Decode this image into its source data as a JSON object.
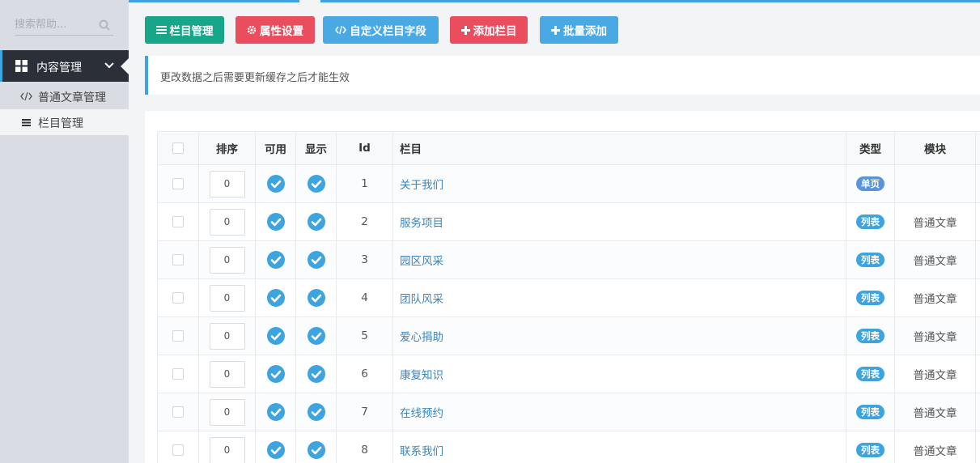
{
  "sidebar": {
    "search_placeholder": "搜索帮助...",
    "menu": {
      "label": "内容管理",
      "items": [
        {
          "label": "普通文章管理",
          "icon": "code-icon"
        },
        {
          "label": "栏目管理",
          "icon": "list-icon"
        }
      ]
    }
  },
  "toolbar": {
    "column_manage": "栏目管理",
    "attribute_settings": "属性设置",
    "custom_fields": "自定义栏目字段",
    "add_column": "添加栏目",
    "batch_add": "批量添加"
  },
  "notice": "更改数据之后需要更新缓存之后才能生效",
  "table": {
    "headers": {
      "sort": "排序",
      "enabled": "可用",
      "visible": "显示",
      "id": "Id",
      "column": "栏目",
      "type": "类型",
      "module": "模块"
    },
    "rows": [
      {
        "sort": "0",
        "id": "1",
        "name": "关于我们",
        "type": "单页",
        "module": ""
      },
      {
        "sort": "0",
        "id": "2",
        "name": "服务项目",
        "type": "列表",
        "module": "普通文章"
      },
      {
        "sort": "0",
        "id": "3",
        "name": "园区风采",
        "type": "列表",
        "module": "普通文章"
      },
      {
        "sort": "0",
        "id": "4",
        "name": "团队风采",
        "type": "列表",
        "module": "普通文章"
      },
      {
        "sort": "0",
        "id": "5",
        "name": "爱心捐助",
        "type": "列表",
        "module": "普通文章"
      },
      {
        "sort": "0",
        "id": "6",
        "name": "康复知识",
        "type": "列表",
        "module": "普通文章"
      },
      {
        "sort": "0",
        "id": "7",
        "name": "在线预约",
        "type": "列表",
        "module": "普通文章"
      },
      {
        "sort": "0",
        "id": "8",
        "name": "联系我们",
        "type": "列表",
        "module": "普通文章"
      }
    ]
  },
  "colors": {
    "accent": "#3ea4e0",
    "teal": "#18a689",
    "red": "#ea4e5e",
    "sidebar_dark": "#2b2f38"
  }
}
